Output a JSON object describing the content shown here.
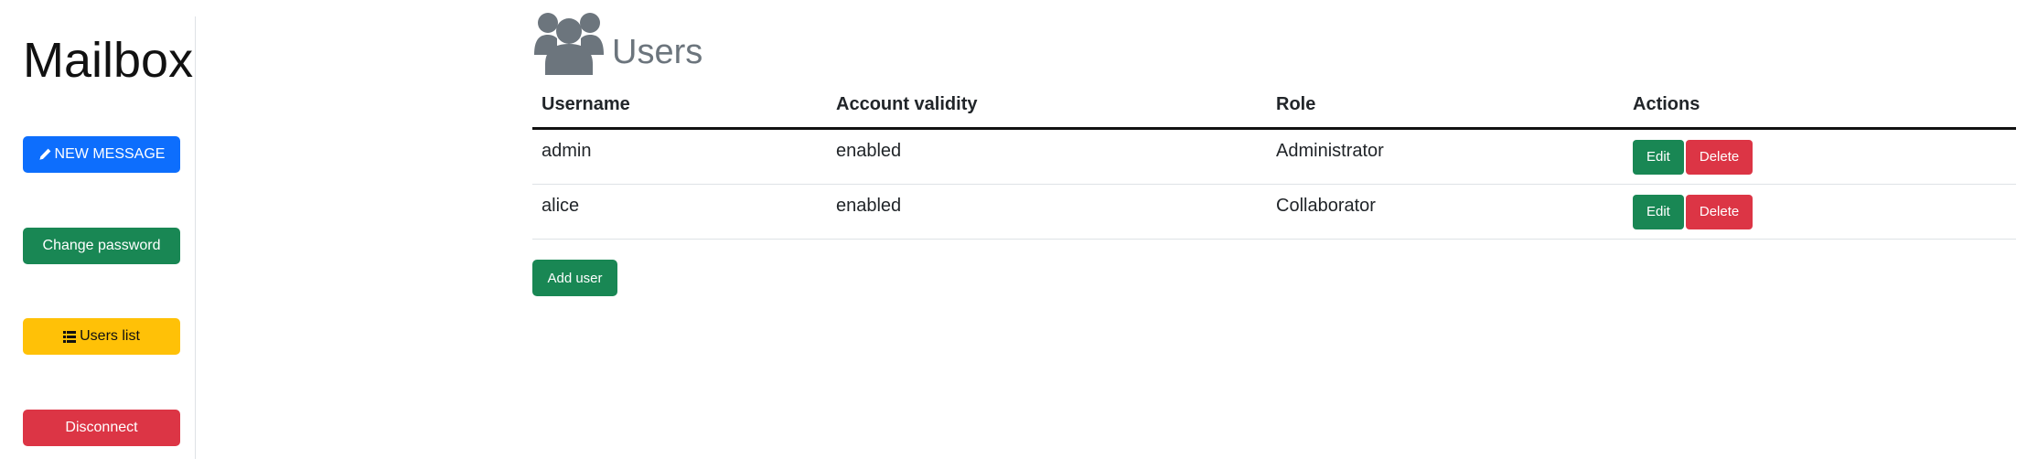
{
  "sidebar": {
    "brand": "Mailbox",
    "new_message": {
      "label": "NEW MESSAGE",
      "icon": "pencil-icon"
    },
    "change_password": {
      "label": "Change password"
    },
    "users_list": {
      "label": "Users list",
      "icon": "list-icon"
    },
    "disconnect": {
      "label": "Disconnect"
    }
  },
  "page": {
    "title": "Users",
    "icon": "users-icon"
  },
  "table": {
    "headers": [
      "Username",
      "Account validity",
      "Role",
      "Actions"
    ],
    "rows": [
      {
        "username": "admin",
        "validity": "enabled",
        "role": "Administrator",
        "edit": "Edit",
        "delete": "Delete"
      },
      {
        "username": "alice",
        "validity": "enabled",
        "role": "Collaborator",
        "edit": "Edit",
        "delete": "Delete"
      }
    ]
  },
  "add_user_label": "Add user",
  "colors": {
    "primary": "#0d6efd",
    "success": "#198754",
    "warning": "#ffc107",
    "danger": "#dc3545",
    "muted": "#6c757d"
  }
}
